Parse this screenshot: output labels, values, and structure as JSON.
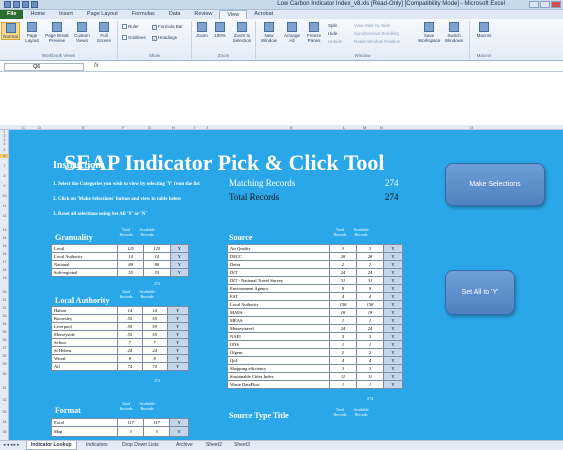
{
  "window": {
    "title": "Low Carbon Indicator Index_v8.xls [Read-Only] [Compatibility Mode] - Microsoft Excel"
  },
  "ribbon_tabs": [
    "File",
    "Home",
    "Insert",
    "Page Layout",
    "Formulas",
    "Data",
    "Review",
    "View",
    "Acrobat"
  ],
  "ribbon": {
    "workbook_views": {
      "label": "Workbook Views",
      "buttons": [
        "Normal",
        "Page Layout",
        "Page Break Preview",
        "Custom Views",
        "Full Screen"
      ]
    },
    "show": {
      "label": "Show",
      "checks": [
        {
          "text": "Ruler",
          "checked": false
        },
        {
          "text": "Formula Bar",
          "checked": true
        },
        {
          "text": "Gridlines",
          "checked": false
        },
        {
          "text": "Headings",
          "checked": true
        }
      ]
    },
    "zoom": {
      "label": "Zoom",
      "buttons": [
        "Zoom",
        "100%",
        "Zoom to Selection"
      ]
    },
    "window": {
      "label": "Window",
      "buttons": [
        "New Window",
        "Arrange All",
        "Freeze Panes"
      ],
      "small": [
        "Split",
        "Hide",
        "Unhide",
        "View Side by Side",
        "Synchronous Scrolling",
        "Reset Window Position"
      ],
      "buttons2": [
        "Save Workspace",
        "Switch Windows"
      ]
    },
    "macros": {
      "label": "Macros",
      "buttons": [
        "Macros"
      ]
    }
  },
  "formula_bar": {
    "name_box": "Q6",
    "fx": "fx",
    "value": ""
  },
  "columns": [
    "C",
    "D",
    "E",
    "F",
    "G",
    "H",
    "I",
    "J",
    "K",
    "L",
    "M",
    "N",
    "O"
  ],
  "rows": [
    "1",
    "2",
    "3",
    "4",
    "5",
    "6",
    "7",
    "8",
    "9",
    "10",
    "11",
    "12",
    "13",
    "14",
    "15",
    "16",
    "17",
    "18",
    "19",
    "20",
    "21",
    "22",
    "23",
    "24",
    "25",
    "26",
    "27",
    "28",
    "29",
    "30",
    "31",
    "32",
    "33",
    "34",
    "35"
  ],
  "sheet": {
    "title": "SEAP Indicator Pick & Click Tool",
    "instructions_heading": "Instructions",
    "instructions": [
      "1. Select the Categories you wish to view by selecting 'Y' from the list",
      "2. Click on 'Make Selections' button and view in table below",
      "3. Reset all selections using Set All 'Y' or 'N'"
    ],
    "matching_label": "Matching Records",
    "matching_value": "274",
    "total_label": "Total Records",
    "total_value": "274",
    "make_selections": "Make Selections",
    "set_all": "Set All to 'Y'",
    "col_total": "Total Records",
    "col_available": "Available Records",
    "granularity": {
      "heading": "Granuality",
      "rows": [
        [
          "Local",
          "125",
          "125",
          "Y"
        ],
        [
          "Local Authority",
          "14",
          "14",
          "Y"
        ],
        [
          "National",
          "80",
          "80",
          "Y"
        ],
        [
          "Sub-regional",
          "55",
          "55",
          "Y"
        ]
      ],
      "total": "274"
    },
    "local_authority": {
      "heading": "Local Authority",
      "rows": [
        [
          "Halton",
          "14",
          "14",
          "Y"
        ],
        [
          "Knowsley",
          "55",
          "55",
          "Y"
        ],
        [
          "Liverpool",
          "59",
          "59",
          "Y"
        ],
        [
          "Merseyside",
          "55",
          "55",
          "Y"
        ],
        [
          "Sefton",
          "7",
          "7",
          "Y"
        ],
        [
          "St Helens",
          "24",
          "24",
          "Y"
        ],
        [
          "Wirral",
          "8",
          "8",
          "Y"
        ],
        [
          "All",
          "74",
          "74",
          "Y"
        ]
      ],
      "total": "274"
    },
    "format": {
      "heading": "Format",
      "rows": [
        [
          "Excel",
          "117",
          "117",
          "Y"
        ],
        [
          "Map",
          "3",
          "3",
          "Y"
        ],
        [
          "",
          "",
          "",
          ""
        ]
      ]
    },
    "source": {
      "heading": "Source",
      "rows": [
        [
          "Air Quality",
          "3",
          "3",
          "Y"
        ],
        [
          "DECC",
          "28",
          "28",
          "Y"
        ],
        [
          "Defra",
          "2",
          "2",
          "Y"
        ],
        [
          "DfT",
          "24",
          "24",
          "Y"
        ],
        [
          "DfT - National Travel Survey",
          "31",
          "31",
          "Y"
        ],
        [
          "Environment Agency",
          "9",
          "9",
          "Y"
        ],
        [
          "EST",
          "4",
          "4",
          "Y"
        ],
        [
          "Local Authority",
          "158",
          "158",
          "Y"
        ],
        [
          "MAES",
          "18",
          "18",
          "Y"
        ],
        [
          "MEAS",
          "1",
          "1",
          "Y"
        ],
        [
          "Merseytravel",
          "24",
          "24",
          "Y"
        ],
        [
          "NAEI",
          "5",
          "5",
          "Y"
        ],
        [
          "ONS",
          "1",
          "1",
          "Y"
        ],
        [
          "Ofgem",
          "2",
          "2",
          "Y"
        ],
        [
          "QoL",
          "4",
          "4",
          "Y"
        ],
        [
          "Shopping efficiency",
          "3",
          "3",
          "Y"
        ],
        [
          "Sustainable Cities Index",
          "11",
          "11",
          "Y"
        ],
        [
          "Waste DataFlow",
          "1",
          "1",
          "Y"
        ]
      ],
      "total": "274"
    },
    "source_type": {
      "heading": "Source Type Title"
    }
  },
  "sheet_tabs": [
    "Indicator Lookup",
    "Indicators",
    "Drop Down Lists",
    "Archive",
    "Sheet2",
    "Sheet3"
  ]
}
